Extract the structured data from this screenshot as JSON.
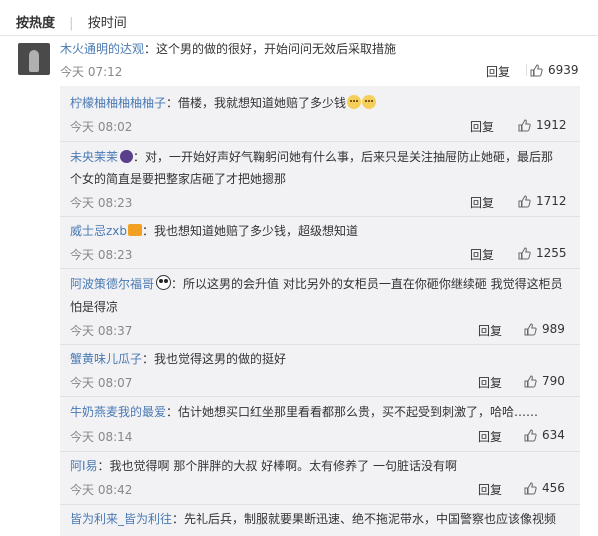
{
  "tabs": {
    "hot": "按热度",
    "time": "按时间"
  },
  "main_comment": {
    "user": "木火通明的达观",
    "text": "：这个男的做的很好，开始问问无效后采取措施",
    "time": "今天 07:12",
    "reply": "回复",
    "likes": "6939"
  },
  "replies": [
    {
      "user": "柠檬柚柚柚柚柚子",
      "line1": "：借楼，我就想知道她赔了多少钱",
      "line2": "",
      "time": "今天 08:02",
      "reply": "回复",
      "likes": "1912",
      "icon": "emoji-icon"
    },
    {
      "user": "未央茉茉",
      "line1": "：对，一开始好声好气鞠躬问她有什么事，后来只是关注抽屉防止她砸，最后那",
      "line2": "个女的简直是要把整家店砸了才把她摁那",
      "time": "今天 08:23",
      "reply": "回复",
      "likes": "1712",
      "icon": "badge-icon"
    },
    {
      "user": "威士忌zxb",
      "line1": "：我也想知道她赔了多少钱，超级想知道",
      "line2": "",
      "time": "今天 08:23",
      "reply": "回复",
      "likes": "1255",
      "icon": "crown-icon"
    },
    {
      "user": "阿波策德尔福哥",
      "line1": "：所以这男的会升值 对比另外的女柜员一直在你砸你继续砸 我觉得这柜员",
      "line2": "怕是得凉",
      "time": "今天 08:37",
      "reply": "回复",
      "likes": "989",
      "icon": "panda-icon"
    },
    {
      "user": "蟹黄味儿瓜子",
      "line1": "：我也觉得这男的做的挺好",
      "line2": "",
      "time": "今天 08:07",
      "reply": "回复",
      "likes": "790",
      "icon": ""
    },
    {
      "user": "牛奶燕麦我的最爱",
      "line1": "：估计她想买口红坐那里看看都那么贵，买不起受到刺激了，哈哈……",
      "line2": "",
      "time": "今天 08:14",
      "reply": "回复",
      "likes": "634",
      "icon": ""
    },
    {
      "user": "阿I易",
      "line1": "：我也觉得啊 那个胖胖的大叔 好棒啊。太有修养了 一句脏话没有啊",
      "line2": "",
      "time": "今天 08:42",
      "reply": "回复",
      "likes": "456",
      "icon": ""
    },
    {
      "user": "皆为利来_皆为利往",
      "line1": "：先礼后兵，制服就要果断迅速、绝不拖泥带水，中国警察也应该像视频",
      "line2": "",
      "time": "",
      "reply": "",
      "likes": "",
      "icon": ""
    }
  ]
}
